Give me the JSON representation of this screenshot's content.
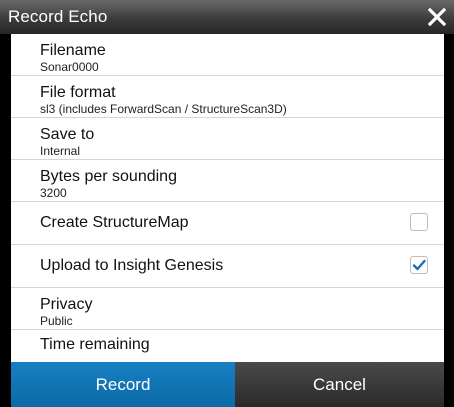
{
  "dialog": {
    "title": "Record Echo",
    "close_icon": "close-icon"
  },
  "settings": {
    "filename": {
      "label": "Filename",
      "value": "Sonar0000"
    },
    "file_format": {
      "label": "File format",
      "value": "sl3 (includes ForwardScan / StructureScan3D)"
    },
    "save_to": {
      "label": "Save to",
      "value": "Internal"
    },
    "bytes_per_sounding": {
      "label": "Bytes per sounding",
      "value": "3200"
    },
    "create_structuremap": {
      "label": "Create StructureMap",
      "checked": false
    },
    "upload_insight_genesis": {
      "label": "Upload to Insight Genesis",
      "checked": true
    },
    "privacy": {
      "label": "Privacy",
      "value": "Public"
    },
    "time_remaining": {
      "label": "Time remaining"
    }
  },
  "footer": {
    "record_label": "Record",
    "cancel_label": "Cancel"
  },
  "colors": {
    "accent": "#1177bb",
    "check": "#1a6fb5",
    "title_bar": "#3c3c3c"
  }
}
